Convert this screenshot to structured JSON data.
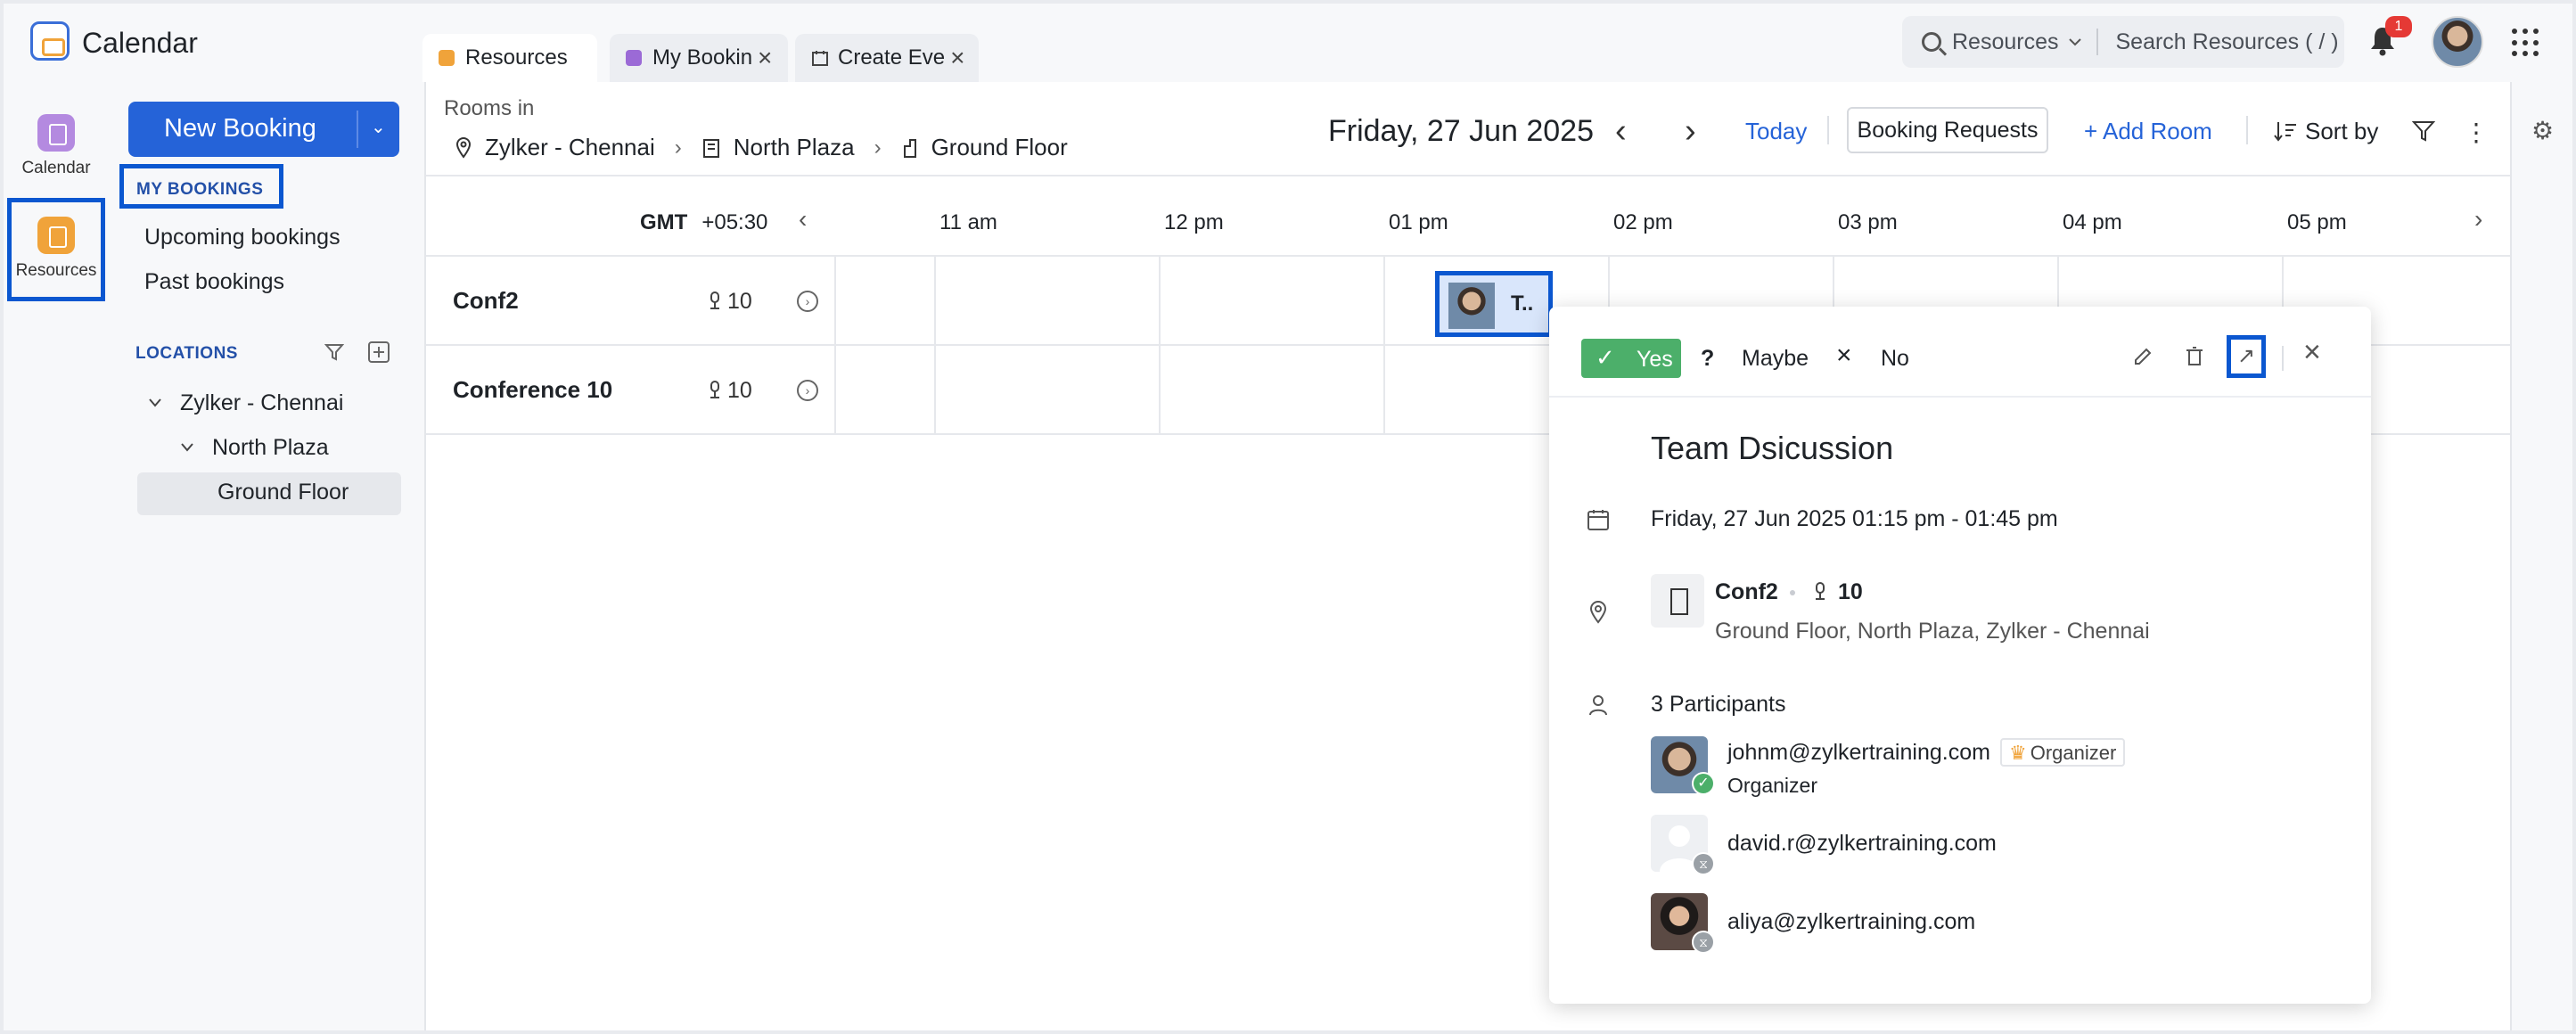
{
  "app": {
    "title": "Calendar"
  },
  "tabs": [
    {
      "label": "Resources",
      "icon": "resources-icon",
      "color": "#f0a33a"
    },
    {
      "label": "My Bookin",
      "icon": "bookings-icon",
      "color": "#9b6ad6"
    },
    {
      "label": "Create Eve",
      "icon": "create-event-icon"
    }
  ],
  "search": {
    "scope": "Resources",
    "placeholder": "Search Resources ( / )"
  },
  "notifications": {
    "count": "1"
  },
  "rail": [
    {
      "label": "Calendar",
      "color": "#b48ae0"
    },
    {
      "label": "Resources",
      "color": "#f0a33a"
    }
  ],
  "sidebar": {
    "new_booking": "New Booking",
    "my_bookings_title": "MY BOOKINGS",
    "upcoming": "Upcoming bookings",
    "past": "Past bookings",
    "locations_title": "LOCATIONS",
    "tree": [
      "Zylker - Chennai",
      "North Plaza",
      "Ground Floor"
    ]
  },
  "header": {
    "rooms_in": "Rooms in",
    "breadcrumb": [
      "Zylker - Chennai",
      "North Plaza",
      "Ground Floor"
    ],
    "date": "Friday, 27 Jun 2025",
    "today": "Today",
    "booking_requests": "Booking Requests",
    "add_room": "+ Add Room",
    "sort_by": "Sort by"
  },
  "timeline": {
    "gmt_label": "GMT",
    "gmt_offset": "+05:30",
    "hours": [
      "11 am",
      "12 pm",
      "01 pm",
      "02 pm",
      "03 pm",
      "04 pm",
      "05 pm"
    ]
  },
  "rooms": [
    {
      "name": "Conf2",
      "capacity": "10"
    },
    {
      "name": "Conference 10",
      "capacity": "10"
    }
  ],
  "event_chip": {
    "label": "T.."
  },
  "popup": {
    "rsvp": {
      "yes": "Yes",
      "maybe_icon": "?",
      "maybe": "Maybe",
      "no": "No"
    },
    "title": "Team Dsicussion",
    "datetime": "Friday, 27 Jun 2025 01:15 pm - 01:45 pm",
    "room_name": "Conf2",
    "room_capacity": "10",
    "room_location": "Ground Floor, North Plaza, Zylker - Chennai",
    "participants_count": "3 Participants",
    "organizer_tag": "Organizer",
    "participants": [
      {
        "email": "johnm@zylkertraining.com",
        "role": "Organizer",
        "status": "accepted"
      },
      {
        "email": "david.r@zylkertraining.com",
        "role": "",
        "status": "pending"
      },
      {
        "email": "aliya@zylkertraining.com",
        "role": "",
        "status": "pending"
      }
    ]
  },
  "colors": {
    "accent": "#2563d8",
    "highlight": "#0b57d0",
    "accept": "#4caf6a"
  }
}
